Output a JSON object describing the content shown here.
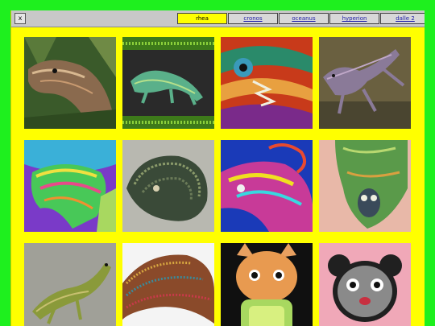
{
  "window": {
    "close_label": "x",
    "tabs": [
      {
        "label": "rhea",
        "active": true
      },
      {
        "label": "cronos",
        "active": false
      },
      {
        "label": "oceanus",
        "active": false
      },
      {
        "label": "hyperion",
        "active": false
      },
      {
        "label": "dalle 2",
        "active": false
      }
    ]
  },
  "colors": {
    "page_background": "#1ef01e",
    "window_background": "#ffff00",
    "tab_link": "#1a1aa8"
  }
}
